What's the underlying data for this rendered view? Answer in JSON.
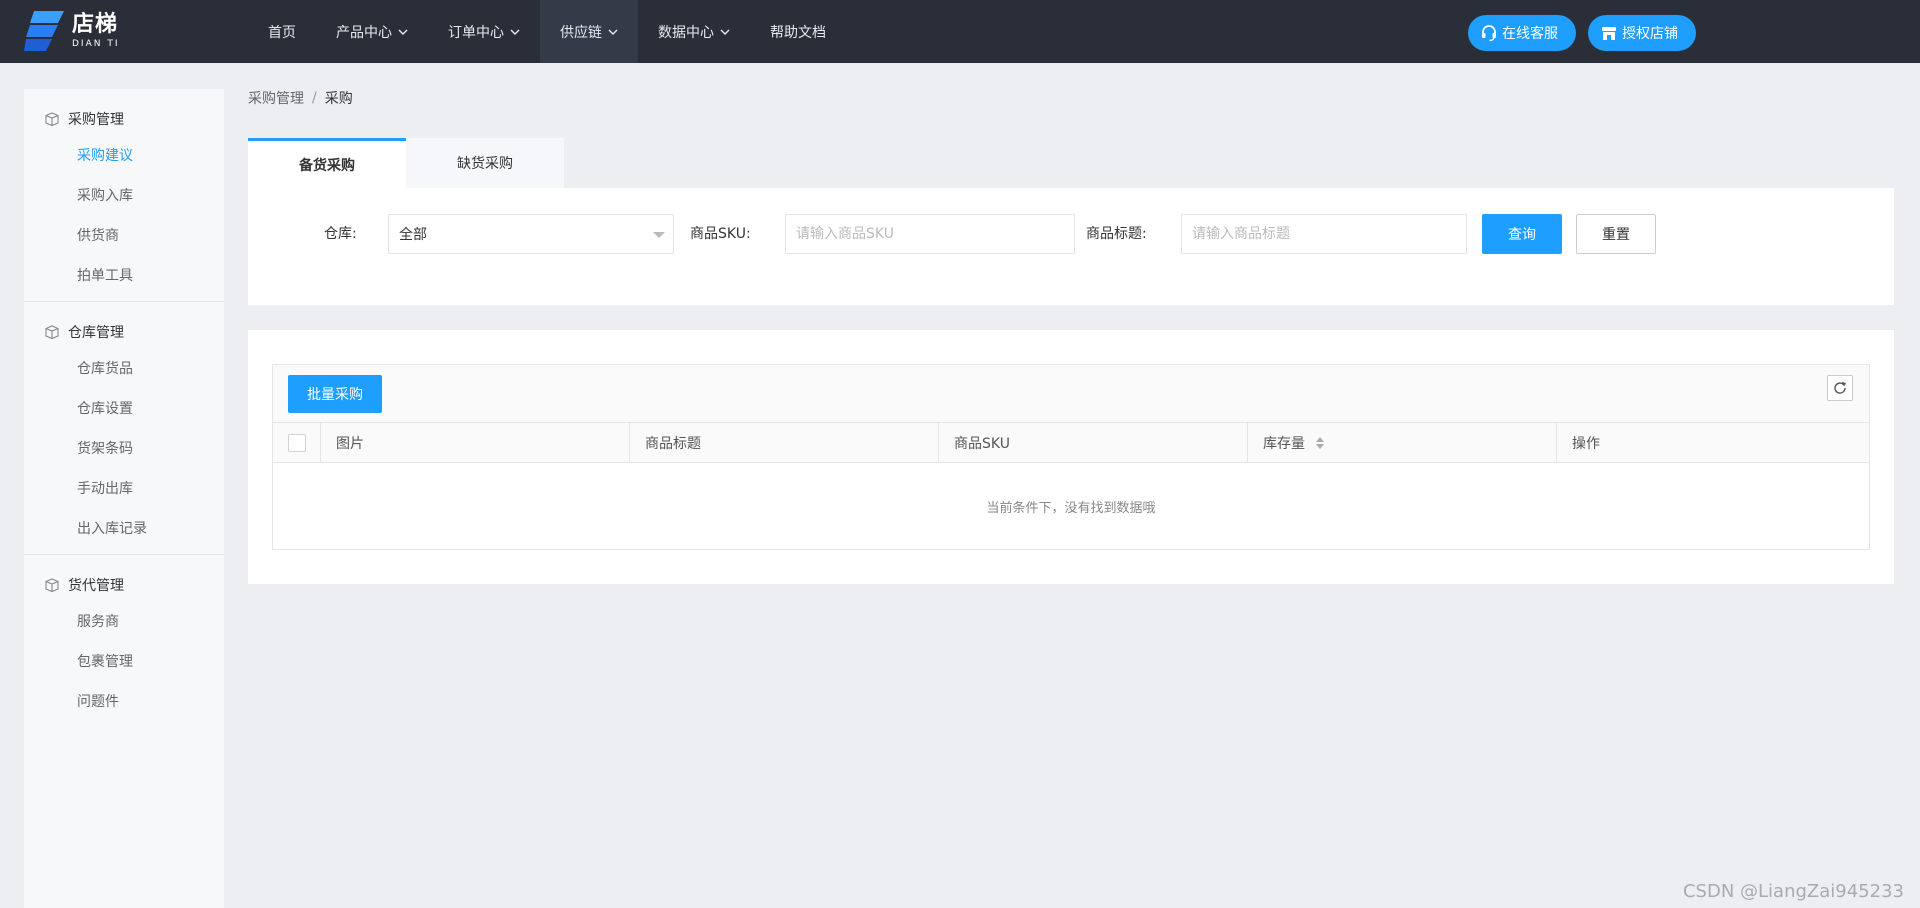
{
  "header": {
    "logo": {
      "title": "店梯",
      "subtitle": "DIAN TI"
    },
    "nav": [
      {
        "label": "首页",
        "has_dropdown": false,
        "active": false
      },
      {
        "label": "产品中心",
        "has_dropdown": true,
        "active": false
      },
      {
        "label": "订单中心",
        "has_dropdown": true,
        "active": false
      },
      {
        "label": "供应链",
        "has_dropdown": true,
        "active": true
      },
      {
        "label": "数据中心",
        "has_dropdown": true,
        "active": false
      },
      {
        "label": "帮助文档",
        "has_dropdown": false,
        "active": false
      }
    ],
    "online_service_label": "在线客服",
    "authorize_store_label": "授权店铺"
  },
  "sidebar": {
    "groups": [
      {
        "title": "采购管理",
        "items": [
          {
            "label": "采购建议",
            "active": true
          },
          {
            "label": "采购入库",
            "active": false
          },
          {
            "label": "供货商",
            "active": false
          },
          {
            "label": "拍单工具",
            "active": false
          }
        ]
      },
      {
        "title": "仓库管理",
        "items": [
          {
            "label": "仓库货品",
            "active": false
          },
          {
            "label": "仓库设置",
            "active": false
          },
          {
            "label": "货架条码",
            "active": false
          },
          {
            "label": "手动出库",
            "active": false
          },
          {
            "label": "出入库记录",
            "active": false
          }
        ]
      },
      {
        "title": "货代管理",
        "items": [
          {
            "label": "服务商",
            "active": false
          },
          {
            "label": "包裹管理",
            "active": false
          },
          {
            "label": "问题件",
            "active": false
          }
        ]
      }
    ]
  },
  "breadcrumb": {
    "parent": "采购管理",
    "separator": "/",
    "current": "采购"
  },
  "tabs": [
    {
      "label": "备货采购",
      "active": true
    },
    {
      "label": "缺货采购",
      "active": false
    }
  ],
  "filters": {
    "warehouse_label": "仓库:",
    "warehouse_value": "全部",
    "sku_label": "商品SKU:",
    "sku_placeholder": "请输入商品SKU",
    "sku_value": "",
    "title_label": "商品标题:",
    "title_placeholder": "请输入商品标题",
    "title_value": "",
    "query_label": "查询",
    "reset_label": "重置"
  },
  "table": {
    "batch_label": "批量采购",
    "columns": [
      "图片",
      "商品标题",
      "商品SKU",
      "库存量",
      "操作"
    ],
    "empty_text": "当前条件下，没有找到数据哦",
    "rows": []
  },
  "watermark": "CSDN @LiangZai945233",
  "colors": {
    "accent": "#1e9fff",
    "topbar": "#2a2e38",
    "background": "#eceef2"
  }
}
